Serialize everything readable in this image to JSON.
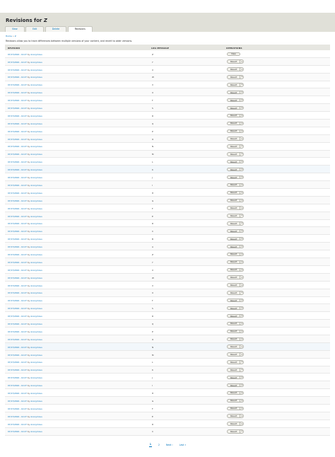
{
  "header": {
    "title_prefix": "Revisions for",
    "title_node": "Z",
    "tabs": [
      {
        "label": "View",
        "active": false
      },
      {
        "label": "Edit",
        "active": false
      },
      {
        "label": "Delete",
        "active": false
      },
      {
        "label": "Revisions",
        "active": true
      }
    ]
  },
  "breadcrumb": {
    "home": "Home",
    "separator": "»",
    "current": "Z"
  },
  "description": "Revisions allow you to track differences between multiple versions of your content, and revert to older versions.",
  "table": {
    "headers": {
      "revision": "REVISION",
      "log": "LOG MESSAGE",
      "operations": "OPERATIONS"
    },
    "date_text": "07/17/2016 - 14:47",
    "by_text": "by",
    "author": "Anonymous",
    "view_label": "View",
    "revert_label": "Revert",
    "caret": "▾",
    "rows": [
      {
        "log": "Z",
        "current": true
      },
      {
        "log": "Y"
      },
      {
        "log": "X"
      },
      {
        "log": "W"
      },
      {
        "log": "V"
      },
      {
        "log": "U"
      },
      {
        "log": "T"
      },
      {
        "log": "S"
      },
      {
        "log": "R"
      },
      {
        "log": "Q"
      },
      {
        "log": "P"
      },
      {
        "log": "O"
      },
      {
        "log": "N"
      },
      {
        "log": "M"
      },
      {
        "log": "L"
      },
      {
        "log": "K"
      },
      {
        "log": "J"
      },
      {
        "log": "I"
      },
      {
        "log": "H"
      },
      {
        "log": "G"
      },
      {
        "log": "F"
      },
      {
        "log": "E"
      },
      {
        "log": "D"
      },
      {
        "log": "C"
      },
      {
        "log": "B"
      },
      {
        "log": "A"
      },
      {
        "log": "Z"
      },
      {
        "log": "Y"
      },
      {
        "log": "X"
      },
      {
        "log": "W"
      },
      {
        "log": "V"
      },
      {
        "log": "U"
      },
      {
        "log": "T"
      },
      {
        "log": "S"
      },
      {
        "log": "R"
      },
      {
        "log": "Q"
      },
      {
        "log": "P"
      },
      {
        "log": "O"
      },
      {
        "log": "N"
      },
      {
        "log": "M"
      },
      {
        "log": "L"
      },
      {
        "log": "K"
      },
      {
        "log": "J"
      },
      {
        "log": "I"
      },
      {
        "log": "H"
      },
      {
        "log": "G"
      },
      {
        "log": "F"
      },
      {
        "log": "E"
      },
      {
        "log": "D"
      },
      {
        "log": "C"
      }
    ]
  },
  "pager": {
    "current": "1",
    "next_page": "2",
    "next_label": "Next ›",
    "last_label": "Last »"
  },
  "colors": {
    "link": "#0074bd",
    "header_bg": "#e0e0d8",
    "table_head_bg": "#e6e6e1",
    "button_bg": "#f2f1eb"
  }
}
